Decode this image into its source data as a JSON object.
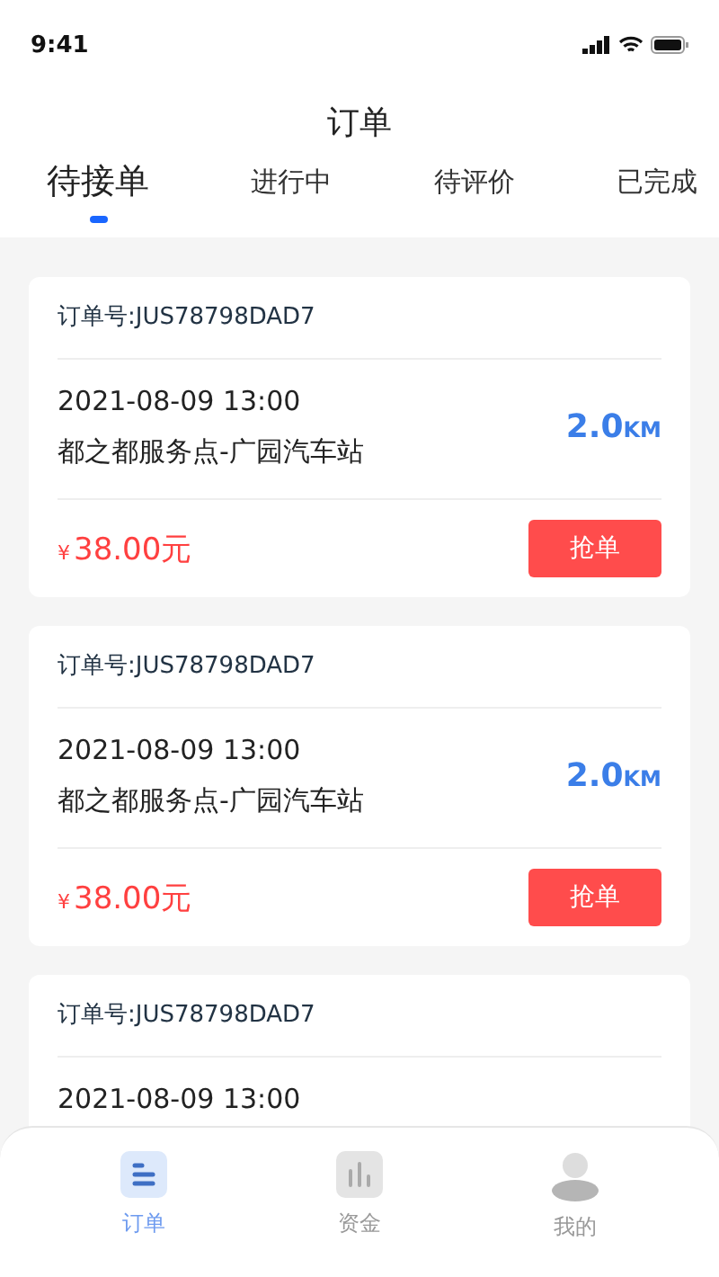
{
  "status_bar": {
    "time": "9:41"
  },
  "header": {
    "title": "订单"
  },
  "tabs": [
    {
      "label": "待接单",
      "selected": true
    },
    {
      "label": "进行中",
      "selected": false
    },
    {
      "label": "待评价",
      "selected": false
    },
    {
      "label": "已完成",
      "selected": false
    }
  ],
  "orders": [
    {
      "order_no": "订单号:JUS78798DAD7",
      "datetime": "2021-08-09 13:00",
      "route": "都之都服务点-广园汽车站",
      "distance": "2.0",
      "distance_unit": "KM",
      "currency": "¥",
      "price": "38.00元",
      "action": "抢单"
    },
    {
      "order_no": "订单号:JUS78798DAD7",
      "datetime": "2021-08-09 13:00",
      "route": "都之都服务点-广园汽车站",
      "distance": "2.0",
      "distance_unit": "KM",
      "currency": "¥",
      "price": "38.00元",
      "action": "抢单"
    },
    {
      "order_no": "订单号:JUS78798DAD7",
      "datetime": "2021-08-09 13:00"
    }
  ],
  "bottom_nav": [
    {
      "kind": "orders",
      "label": "订单",
      "selected": true
    },
    {
      "kind": "funds",
      "label": "资金",
      "selected": false
    },
    {
      "kind": "profile",
      "label": "我的",
      "selected": false
    }
  ]
}
